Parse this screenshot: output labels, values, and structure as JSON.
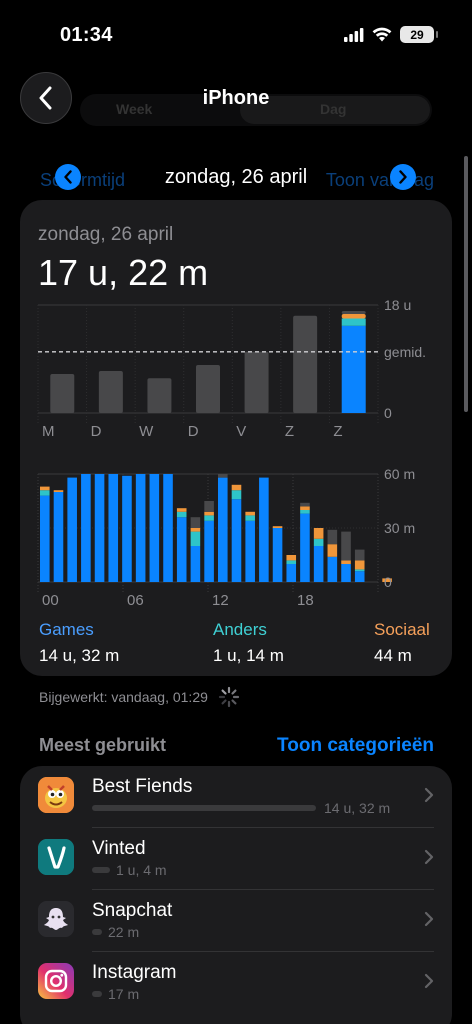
{
  "status": {
    "time": "01:34",
    "battery": "29"
  },
  "nav": {
    "title": "iPhone",
    "segment_week": "Week",
    "segment_day": "Dag"
  },
  "date_nav": {
    "date": "zondag, 26 april",
    "ghost_left": "Schermtijd",
    "ghost_right": "Toon van dag"
  },
  "summary": {
    "day_label": "zondag, 26 april",
    "total": "17 u, 22 m"
  },
  "chart_data": [
    {
      "type": "bar",
      "categories": [
        "M",
        "D",
        "W",
        "D",
        "V",
        "Z",
        "Z"
      ],
      "series": [
        {
          "name": "Games",
          "values": [
            0,
            0,
            0,
            0,
            0,
            0,
            14.53
          ],
          "color": "#0a84ff"
        },
        {
          "name": "Anders",
          "values": [
            0,
            0,
            0,
            0,
            0,
            0,
            1.23
          ],
          "color": "#2ec4c8"
        },
        {
          "name": "Sociaal",
          "values": [
            0,
            0,
            0,
            0,
            0,
            0,
            0.73
          ],
          "color": "#f0963a"
        },
        {
          "name": "",
          "values": [
            6.5,
            7.0,
            5.8,
            8.0,
            10.2,
            16.2,
            0.5
          ],
          "color": "#48484a"
        }
      ],
      "ylim": [
        0,
        18
      ],
      "y_ticks": [
        "18 u",
        "0"
      ],
      "average_label": "gemid.",
      "average_value": 10.2
    },
    {
      "type": "bar",
      "x_ticks": [
        "00",
        "06",
        "12",
        "18"
      ],
      "hours": 24,
      "ylim": [
        0,
        60
      ],
      "y_ticks": [
        "60 m",
        "30 m",
        "0"
      ],
      "series": [
        {
          "name": "Games",
          "color": "#0a84ff",
          "values": [
            48,
            50,
            58,
            60,
            60,
            60,
            59,
            60,
            60,
            60,
            36,
            20,
            34,
            58,
            46,
            34,
            58,
            30,
            10,
            38,
            20,
            14,
            10,
            6,
            0,
            0
          ]
        },
        {
          "name": "Anders",
          "color": "#2ec4c8",
          "values": [
            3,
            0,
            0,
            0,
            0,
            0,
            0,
            0,
            0,
            0,
            3,
            8,
            3,
            0,
            5,
            3,
            0,
            0,
            2,
            2,
            4,
            0,
            0,
            1,
            0,
            0
          ]
        },
        {
          "name": "Sociaal",
          "color": "#f0963a",
          "values": [
            2,
            1,
            0,
            0,
            0,
            0,
            0,
            0,
            0,
            0,
            2,
            2,
            2,
            0,
            3,
            2,
            0,
            1,
            3,
            2,
            6,
            7,
            2,
            5,
            0,
            2
          ]
        },
        {
          "name": "",
          "color": "#48484a",
          "values": [
            0,
            0,
            0,
            0,
            0,
            0,
            0,
            0,
            0,
            0,
            0,
            6,
            6,
            2,
            0,
            0,
            0,
            0,
            0,
            2,
            0,
            8,
            16,
            6,
            0,
            0
          ]
        }
      ]
    }
  ],
  "legend": [
    {
      "name": "Games",
      "value": "14 u, 32 m",
      "color": "#4a9eff"
    },
    {
      "name": "Anders",
      "value": "1 u, 14 m",
      "color": "#3fd0d4"
    },
    {
      "name": "Sociaal",
      "value": "44 m",
      "color": "#f5a05a"
    }
  ],
  "updated": "Bijgewerkt: vandaag, 01:29",
  "most_used": {
    "header": "Meest gebruikt",
    "link": "Toon categorieën",
    "apps": [
      {
        "name": "Best Fiends",
        "time": "14 u, 32 m",
        "fraction": 1.0,
        "icon": "best-fiends-icon"
      },
      {
        "name": "Vinted",
        "time": "1 u, 4 m",
        "fraction": 0.07,
        "icon": "vinted-icon"
      },
      {
        "name": "Snapchat",
        "time": "22 m",
        "fraction": 0.03,
        "icon": "snapchat-icon"
      },
      {
        "name": "Instagram",
        "time": "17 m",
        "fraction": 0.025,
        "icon": "instagram-icon"
      }
    ]
  }
}
